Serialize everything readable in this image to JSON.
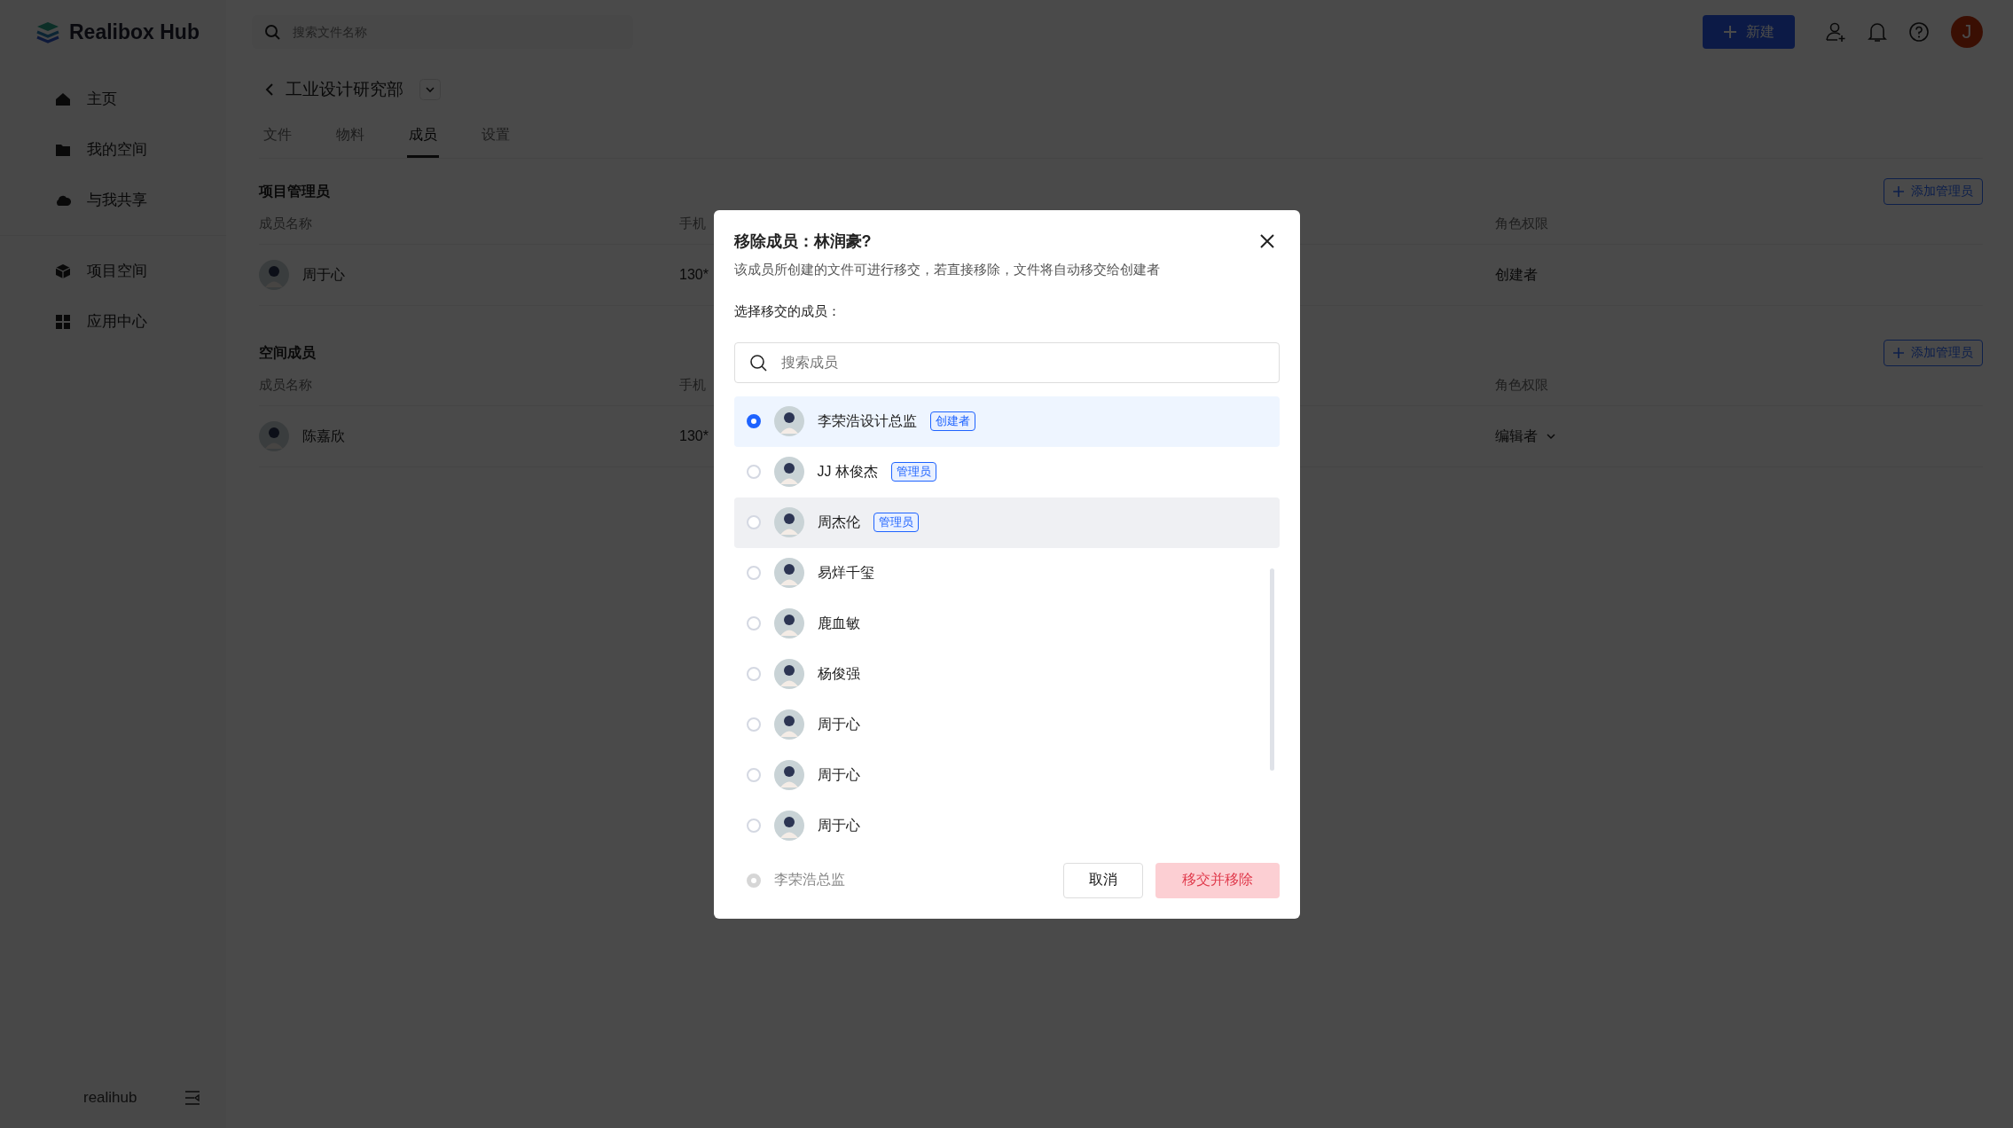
{
  "app": {
    "logo": "Realibox Hub",
    "user_name": "realihub"
  },
  "sidebar": {
    "groups": [
      [
        {
          "label": "主页"
        },
        {
          "label": "我的空间"
        },
        {
          "label": "与我共享"
        }
      ],
      [
        {
          "label": "项目空间"
        },
        {
          "label": "应用中心"
        }
      ]
    ]
  },
  "topbar": {
    "search": {
      "placeholder": "搜索文件名称"
    },
    "new_button": "新建",
    "avatar": "J"
  },
  "page": {
    "title": "工业设计研究部",
    "tabs": [
      {
        "label": "文件",
        "selected": false
      },
      {
        "label": "物料",
        "selected": false
      },
      {
        "label": "成员",
        "selected": true
      },
      {
        "label": "设置",
        "selected": false
      }
    ],
    "sections": [
      {
        "title": "项目管理员",
        "add_button": "添加管理员",
        "columns": [
          "成员名称",
          "手机",
          "角色权限"
        ],
        "rows": [
          {
            "name": "周于心",
            "phone": "130*",
            "role": "创建者",
            "dropdown": false
          }
        ]
      },
      {
        "title": "空间成员",
        "add_button": "添加管理员",
        "columns": [
          "成员名称",
          "手机",
          "角色权限"
        ],
        "rows": [
          {
            "name": "陈嘉欣",
            "phone": "130*",
            "role": "编辑者",
            "dropdown": true
          }
        ]
      }
    ]
  },
  "dialog": {
    "title": "移除成员：林润豪?",
    "description": "该成员所创建的文件可进行移交，若直接移除，文件将自动移交给创建者",
    "prompt": "选择移交的成员：",
    "search": {
      "placeholder": "搜索成员"
    },
    "members": [
      {
        "name": "李荣浩设计总监",
        "tag": "创建者",
        "selected": true,
        "hovered": false
      },
      {
        "name": "JJ 林俊杰",
        "tag": "管理员",
        "selected": false,
        "hovered": false
      },
      {
        "name": "周杰伦",
        "tag": "管理员",
        "selected": false,
        "hovered": true
      },
      {
        "name": "易烊千玺",
        "selected": false,
        "hovered": false
      },
      {
        "name": "鹿血敏",
        "selected": false,
        "hovered": false
      },
      {
        "name": "杨俊强",
        "selected": false,
        "hovered": false
      },
      {
        "name": "周于心",
        "selected": false,
        "hovered": false
      },
      {
        "name": "周于心",
        "selected": false,
        "hovered": false
      },
      {
        "name": "周于心",
        "selected": false,
        "hovered": false
      }
    ],
    "footer": {
      "label": "李荣浩总监",
      "disabled": true,
      "cancel": "取消",
      "confirm": "移交并移除"
    }
  }
}
